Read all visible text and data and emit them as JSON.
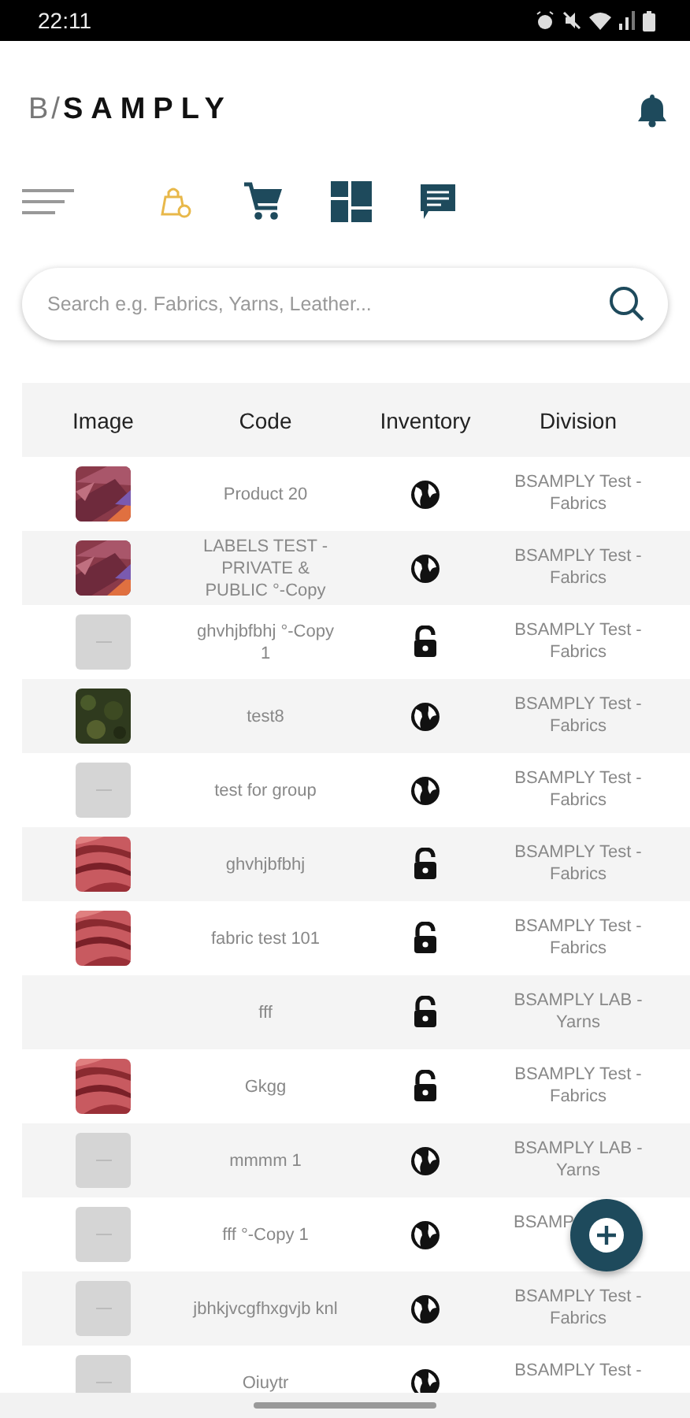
{
  "status_bar": {
    "time": "22:11"
  },
  "header": {
    "logo_prefix": "B/",
    "logo_name": "SAMPLY"
  },
  "search": {
    "placeholder": "Search e.g. Fabrics, Yarns, Leather..."
  },
  "table": {
    "columns": [
      "Image",
      "Code",
      "Inventory",
      "Division"
    ],
    "rows": [
      {
        "code": "Product 20",
        "private": false,
        "division": "BSAMPLY Test - Fabrics"
      },
      {
        "code": "LABELS TEST - PRIVATE & PUBLIC °-Copy",
        "private": false,
        "division": "BSAMPLY Test - Fabrics"
      },
      {
        "image": {
          "kind": "placeholder"
        },
        "code": "ghvhjbfbhj °-Copy 1",
        "private": true,
        "division": "BSAMPLY Test - Fabrics"
      },
      {
        "code": "test8",
        "private": false,
        "division": "BSAMPLY Test - Fabrics"
      },
      {
        "image": {
          "kind": "placeholder"
        },
        "code": "test for group",
        "private": false,
        "division": "BSAMPLY Test - Fabrics"
      },
      {
        "code": "ghvhjbfbhj",
        "private": true,
        "division": "BSAMPLY Test - Fabrics"
      },
      {
        "code": "fabric test 101",
        "private": true,
        "division": "BSAMPLY Test - Fabrics"
      },
      {
        "code": "fff",
        "private": true,
        "division": "BSAMPLY LAB - Yarns"
      },
      {
        "code": "Gkgg",
        "private": true,
        "division": "BSAMPLY Test - Fabrics"
      },
      {
        "image": {
          "kind": "placeholder"
        },
        "code": "mmmm 1",
        "private": false,
        "division": "BSAMPLY LAB - Yarns"
      },
      {
        "image": {
          "kind": "placeholder"
        },
        "code": "fff °-Copy 1",
        "private": false,
        "division": "BSAMP"
      },
      {
        "image": {
          "kind": "placeholder"
        },
        "code": "jbhkjvcgfhxgvjb knl",
        "private": false,
        "division": "BSAMPLY Test - Fabrics"
      },
      {
        "image": {
          "kind": "placeholder"
        },
        "code": "Oiuytr",
        "private": false,
        "division": "BSAMPLY Test -"
      }
    ]
  }
}
